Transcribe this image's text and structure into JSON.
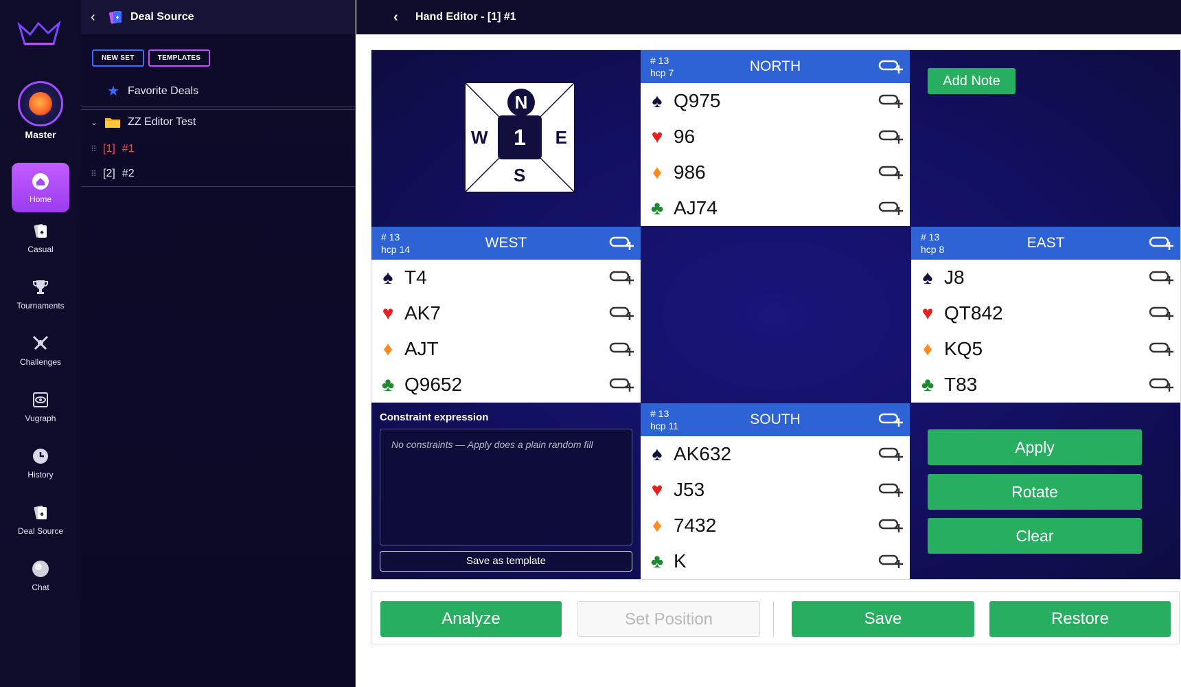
{
  "rail": {
    "user_name": "Master",
    "items": [
      {
        "label": "Home",
        "icon": "home-icon",
        "active": true
      },
      {
        "label": "Casual",
        "icon": "cards-icon"
      },
      {
        "label": "Tournaments",
        "icon": "trophy-icon"
      },
      {
        "label": "Challenges",
        "icon": "swords-icon"
      },
      {
        "label": "Vugraph",
        "icon": "eye-icon"
      },
      {
        "label": "History",
        "icon": "clock-icon"
      },
      {
        "label": "Deal Source",
        "icon": "cards-icon"
      },
      {
        "label": "Chat",
        "icon": "chat-icon"
      }
    ]
  },
  "panel": {
    "title": "Deal Source",
    "new_set": "NEW SET",
    "templates": "TEMPLATES",
    "favorites": "Favorite Deals",
    "folder": "ZZ Editor Test",
    "deals": [
      {
        "tag": "[1]",
        "name": "#1",
        "active": true
      },
      {
        "tag": "[2]",
        "name": "#2",
        "active": false
      }
    ]
  },
  "main": {
    "title": "Hand Editor - [1] #1"
  },
  "compass": {
    "n": "N",
    "e": "E",
    "s": "S",
    "w": "W",
    "board": "1"
  },
  "hands": {
    "north": {
      "name": "NORTH",
      "count": "# 13",
      "hcp": "hcp 7",
      "spades": "Q975",
      "hearts": "96",
      "diamonds": "986",
      "clubs": "AJ74"
    },
    "west": {
      "name": "WEST",
      "count": "# 13",
      "hcp": "hcp 14",
      "spades": "T4",
      "hearts": "AK7",
      "diamonds": "AJT",
      "clubs": "Q9652"
    },
    "east": {
      "name": "EAST",
      "count": "# 13",
      "hcp": "hcp 8",
      "spades": "J8",
      "hearts": "QT842",
      "diamonds": "KQ5",
      "clubs": "T83"
    },
    "south": {
      "name": "SOUTH",
      "count": "# 13",
      "hcp": "hcp 11",
      "spades": "AK632",
      "hearts": "J53",
      "diamonds": "7432",
      "clubs": "K"
    }
  },
  "suits": {
    "spades": "♠",
    "hearts": "♥",
    "diamonds": "♦",
    "clubs": "♣"
  },
  "add_note": "Add Note",
  "constraint": {
    "label": "Constraint expression",
    "placeholder": "No constraints — Apply does a plain random fill",
    "save_template": "Save as template"
  },
  "actions": {
    "apply": "Apply",
    "rotate": "Rotate",
    "clear": "Clear"
  },
  "bottom": {
    "analyze": "Analyze",
    "set_position": "Set Position",
    "save": "Save",
    "restore": "Restore"
  },
  "colors": {
    "accent_green": "#27ae60",
    "hand_header_blue": "#2e63d6",
    "active_red": "#ff4444",
    "nav_purple": "#a14dff"
  }
}
